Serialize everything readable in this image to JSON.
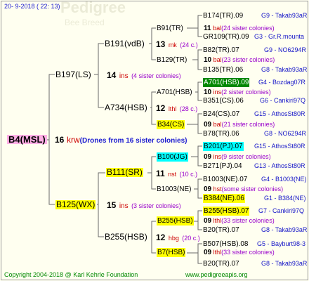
{
  "header": {
    "date": "20-  9-2018 ( 22: 13)"
  },
  "footer": {
    "copyright": "Copyright 2004-2018 @ Karl Kehrle Foundation",
    "website": "www.pedigreeapis.org"
  },
  "watermark": {
    "text1": "Pedigree",
    "text2": "Bee Breed"
  },
  "root": {
    "name": "B4(MSL)",
    "count": "16",
    "breed": "krw",
    "note": "(Drones from 16 sister colonies)"
  },
  "gen2": [
    {
      "name": "B197(LS)",
      "count": "14",
      "breed": "ins",
      "note": "(4 sister colonies)"
    },
    {
      "name": "B125(WX)",
      "count": "15",
      "breed": "ins",
      "note": "(3 sister colonies)"
    }
  ],
  "gen3": [
    {
      "name": "B191(vdB)",
      "count": "13",
      "breed": "mk",
      "note": "(24 c.)"
    },
    {
      "name": "A734(HSB)",
      "count": "12",
      "breed": "lthl",
      "note": "(28 c.)"
    },
    {
      "name": "B111(SR)",
      "count": "11",
      "breed": "nst",
      "note": "(10 c.)"
    },
    {
      "name": "B255(HSB)",
      "count": "12",
      "breed": "hbg",
      "note": "(20 c.)"
    }
  ],
  "gen4": [
    {
      "name": "B91(TR)",
      "count": "11",
      "breed": "bal",
      "note": "(24 sister colonies)"
    },
    {
      "name": "B129(TR)",
      "count": "10",
      "breed": "bal",
      "note": "(23 sister colonies)"
    },
    {
      "name": "A701(HSB)",
      "count": "10",
      "breed": "ins",
      "note": "(2 sister colonies)"
    },
    {
      "name": "B34(CS)",
      "count": "09",
      "breed": "bal",
      "note": "(21 sister colonies)"
    },
    {
      "name": "B100(JG)",
      "count": "09",
      "breed": "ins",
      "note": "(9 sister colonies)"
    },
    {
      "name": "B1003(NE)",
      "count": "09",
      "breed": "hst",
      "note": "(some sister colonies)"
    },
    {
      "name": "B255(HSB)",
      "count": "09",
      "breed": "lthl",
      "note": "(33 sister colonies)"
    },
    {
      "name": "B7(HSB)",
      "count": "09",
      "breed": "lthl",
      "note": "(33 sister colonies)"
    }
  ],
  "gen5": [
    {
      "name": "B174(TR).09",
      "info": "G9 - Takab93aR"
    },
    {
      "name": "GR109(TR).09",
      "info": "G3 - Gr.R.mounta"
    },
    {
      "name": "B82(TR).07",
      "info": "G9 - NO6294R"
    },
    {
      "name": "B135(TR).06",
      "info": "G8 - Takab93aR"
    },
    {
      "name": "A701(HSB).09",
      "info": "G4 - Bozdag07R"
    },
    {
      "name": "B351(CS).06",
      "info": "G6 - Cankiri97Q"
    },
    {
      "name": "B24(CS).07",
      "info": "G15 - AthosSt80R"
    },
    {
      "name": "B78(TR).06",
      "info": "G8 - NO6294R"
    },
    {
      "name": "B201(PJ).07",
      "info": "G15 - AthosSt80R"
    },
    {
      "name": "B271(PJ).04",
      "info": "G13 - AthosSt80R"
    },
    {
      "name": "B1003(NE).07",
      "info": "G4 - B1003(NE)"
    },
    {
      "name": "B384(NE).06",
      "info": "G1 - B384(NE)"
    },
    {
      "name": "B255(HSB).07",
      "info": "G7 - Cankiri97Q"
    },
    {
      "name": "B20(TR).07",
      "info": "G8 - Takab93aR"
    },
    {
      "name": "B507(HSB).08",
      "info": "G5 - Bayburt98-3"
    },
    {
      "name": "B20(TR).07",
      "info": "G8 - Takab93aR"
    }
  ],
  "colors": {
    "line": "#6a6a6a",
    "blue": "#1515c8",
    "red": "#cc0000",
    "highlight_yellow": "#ffff00",
    "highlight_cyan": "#00ffff",
    "highlight_green": "#008800",
    "highlight_pink": "#ffb0e6",
    "footer_green": "#008800"
  }
}
